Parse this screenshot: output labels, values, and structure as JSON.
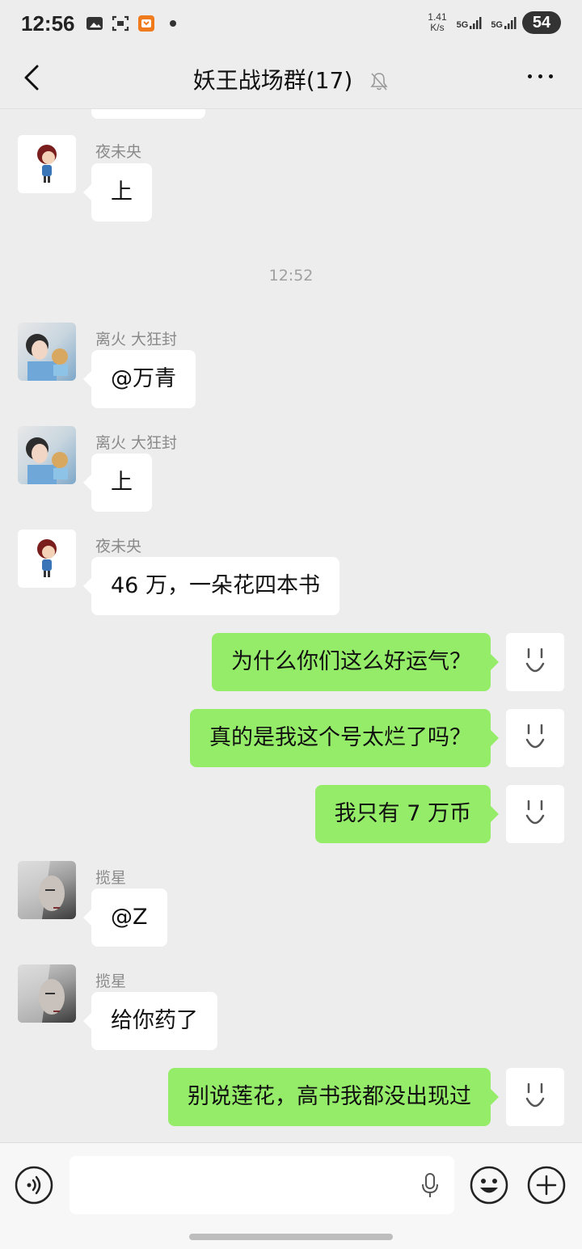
{
  "status": {
    "time": "12:56",
    "speed_value": "1.41",
    "speed_unit": "K/s",
    "net1": "5G",
    "net2": "5G",
    "battery": "54"
  },
  "header": {
    "title": "妖王战场群(17)"
  },
  "messages": [
    {
      "sender": "夜未央",
      "text": "上"
    },
    {
      "timestamp": "12:52"
    },
    {
      "sender": "离火 大狂封",
      "text": "@万青"
    },
    {
      "sender": "离火 大狂封",
      "text": "上"
    },
    {
      "sender": "夜未央",
      "text": "46 万，一朵花四本书"
    },
    {
      "text": "为什么你们这么好运气？"
    },
    {
      "text": "真的是我这个号太烂了吗？"
    },
    {
      "text": "我只有 7 万币"
    },
    {
      "sender": "揽星",
      "text": "@Z"
    },
    {
      "sender": "揽星",
      "text": "给你药了"
    },
    {
      "text": "别说莲花，高书我都没出现过"
    }
  ],
  "input": {
    "placeholder": ""
  },
  "colors": {
    "outgoing_bubble": "#95ec69",
    "incoming_bubble": "#ffffff",
    "background": "#ededed"
  },
  "icons": {
    "back": "chevron-left-icon",
    "mute": "bell-off-icon",
    "more": "more-horizontal-icon",
    "voice": "voice-icon",
    "mic": "mic-icon",
    "emoji": "emoji-icon",
    "plus": "plus-icon"
  }
}
